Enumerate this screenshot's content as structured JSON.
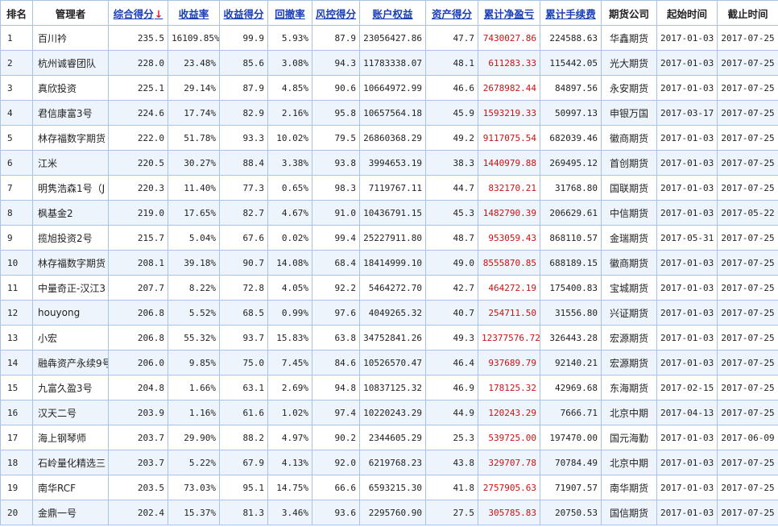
{
  "table": {
    "headers": {
      "rank": "排名",
      "manager": "管理者",
      "score": "综合得分",
      "score_sort_icon": "↓",
      "return_rate": "收益率",
      "return_score": "收益得分",
      "drawdown": "回撤率",
      "risk_score": "风控得分",
      "equity": "账户权益",
      "asset_score": "资产得分",
      "net_pnl": "累计净盈亏",
      "fees": "累计手续费",
      "broker": "期货公司",
      "start": "起始时间",
      "end": "截止时间"
    },
    "rows": [
      {
        "rank": "1",
        "manager": "百川衿",
        "score": "235.5",
        "return_rate": "16109.85%",
        "return_score": "99.9",
        "drawdown": "5.93%",
        "risk_score": "87.9",
        "equity": "23056427.86",
        "asset_score": "47.7",
        "net_pnl": "7430027.86",
        "fees": "224588.63",
        "broker": "华鑫期货",
        "start": "2017-01-03",
        "end": "2017-07-25"
      },
      {
        "rank": "2",
        "manager": "杭州诚睿团队",
        "score": "228.0",
        "return_rate": "23.48%",
        "return_score": "85.6",
        "drawdown": "3.08%",
        "risk_score": "94.3",
        "equity": "11783338.07",
        "asset_score": "48.1",
        "net_pnl": "611283.33",
        "fees": "115442.05",
        "broker": "光大期货",
        "start": "2017-01-03",
        "end": "2017-07-25"
      },
      {
        "rank": "3",
        "manager": "真欣投资",
        "score": "225.1",
        "return_rate": "29.14%",
        "return_score": "87.9",
        "drawdown": "4.85%",
        "risk_score": "90.6",
        "equity": "10664972.99",
        "asset_score": "46.6",
        "net_pnl": "2678982.44",
        "fees": "84897.56",
        "broker": "永安期货",
        "start": "2017-01-03",
        "end": "2017-07-25"
      },
      {
        "rank": "4",
        "manager": "君信康富3号",
        "score": "224.6",
        "return_rate": "17.74%",
        "return_score": "82.9",
        "drawdown": "2.16%",
        "risk_score": "95.8",
        "equity": "10657564.18",
        "asset_score": "45.9",
        "net_pnl": "1593219.33",
        "fees": "50997.13",
        "broker": "申银万国",
        "start": "2017-03-17",
        "end": "2017-07-25"
      },
      {
        "rank": "5",
        "manager": "林存福数字期货",
        "score": "222.0",
        "return_rate": "51.78%",
        "return_score": "93.3",
        "drawdown": "10.02%",
        "risk_score": "79.5",
        "equity": "26860368.29",
        "asset_score": "49.2",
        "net_pnl": "9117075.54",
        "fees": "682039.46",
        "broker": "徽商期货",
        "start": "2017-01-03",
        "end": "2017-07-25"
      },
      {
        "rank": "6",
        "manager": "江米",
        "score": "220.5",
        "return_rate": "30.27%",
        "return_score": "88.4",
        "drawdown": "3.38%",
        "risk_score": "93.8",
        "equity": "3994653.19",
        "asset_score": "38.3",
        "net_pnl": "1440979.88",
        "fees": "269495.12",
        "broker": "首创期货",
        "start": "2017-01-03",
        "end": "2017-07-25"
      },
      {
        "rank": "7",
        "manager": "明隽浩森1号（J",
        "score": "220.3",
        "return_rate": "11.40%",
        "return_score": "77.3",
        "drawdown": "0.65%",
        "risk_score": "98.3",
        "equity": "7119767.11",
        "asset_score": "44.7",
        "net_pnl": "832170.21",
        "fees": "31768.80",
        "broker": "国联期货",
        "start": "2017-01-03",
        "end": "2017-07-25"
      },
      {
        "rank": "8",
        "manager": "枫基金2",
        "score": "219.0",
        "return_rate": "17.65%",
        "return_score": "82.7",
        "drawdown": "4.67%",
        "risk_score": "91.0",
        "equity": "10436791.15",
        "asset_score": "45.3",
        "net_pnl": "1482790.39",
        "fees": "206629.61",
        "broker": "中信期货",
        "start": "2017-01-03",
        "end": "2017-05-22"
      },
      {
        "rank": "9",
        "manager": "揽旭投资2号",
        "score": "215.7",
        "return_rate": "5.04%",
        "return_score": "67.6",
        "drawdown": "0.02%",
        "risk_score": "99.4",
        "equity": "25227911.80",
        "asset_score": "48.7",
        "net_pnl": "953059.43",
        "fees": "868110.57",
        "broker": "金瑞期货",
        "start": "2017-05-31",
        "end": "2017-07-25"
      },
      {
        "rank": "10",
        "manager": "林存福数字期货",
        "score": "208.1",
        "return_rate": "39.18%",
        "return_score": "90.7",
        "drawdown": "14.08%",
        "risk_score": "68.4",
        "equity": "18414999.10",
        "asset_score": "49.0",
        "net_pnl": "8555870.85",
        "fees": "688189.15",
        "broker": "徽商期货",
        "start": "2017-01-03",
        "end": "2017-07-25"
      },
      {
        "rank": "11",
        "manager": "中量奇正-汉江3",
        "score": "207.7",
        "return_rate": "8.22%",
        "return_score": "72.8",
        "drawdown": "4.05%",
        "risk_score": "92.2",
        "equity": "5464272.70",
        "asset_score": "42.7",
        "net_pnl": "464272.19",
        "fees": "175400.83",
        "broker": "宝城期货",
        "start": "2017-01-03",
        "end": "2017-07-25"
      },
      {
        "rank": "12",
        "manager": "houyong",
        "score": "206.8",
        "return_rate": "5.52%",
        "return_score": "68.5",
        "drawdown": "0.99%",
        "risk_score": "97.6",
        "equity": "4049265.32",
        "asset_score": "40.7",
        "net_pnl": "254711.50",
        "fees": "31556.80",
        "broker": "兴证期货",
        "start": "2017-01-03",
        "end": "2017-07-25"
      },
      {
        "rank": "13",
        "manager": "小宏",
        "score": "206.8",
        "return_rate": "55.32%",
        "return_score": "93.7",
        "drawdown": "15.83%",
        "risk_score": "63.8",
        "equity": "34752841.26",
        "asset_score": "49.3",
        "net_pnl": "12377576.72",
        "fees": "326443.28",
        "broker": "宏源期货",
        "start": "2017-01-03",
        "end": "2017-07-25"
      },
      {
        "rank": "14",
        "manager": "融犇资产永续9号",
        "score": "206.0",
        "return_rate": "9.85%",
        "return_score": "75.0",
        "drawdown": "7.45%",
        "risk_score": "84.6",
        "equity": "10526570.47",
        "asset_score": "46.4",
        "net_pnl": "937689.79",
        "fees": "92140.21",
        "broker": "宏源期货",
        "start": "2017-01-03",
        "end": "2017-07-25"
      },
      {
        "rank": "15",
        "manager": "九富久盈3号",
        "score": "204.8",
        "return_rate": "1.66%",
        "return_score": "63.1",
        "drawdown": "2.69%",
        "risk_score": "94.8",
        "equity": "10837125.32",
        "asset_score": "46.9",
        "net_pnl": "178125.32",
        "fees": "42969.68",
        "broker": "东海期货",
        "start": "2017-02-15",
        "end": "2017-07-25"
      },
      {
        "rank": "16",
        "manager": "汉天二号",
        "score": "203.9",
        "return_rate": "1.16%",
        "return_score": "61.6",
        "drawdown": "1.02%",
        "risk_score": "97.4",
        "equity": "10220243.29",
        "asset_score": "44.9",
        "net_pnl": "120243.29",
        "fees": "7666.71",
        "broker": "北京中期",
        "start": "2017-04-13",
        "end": "2017-07-25"
      },
      {
        "rank": "17",
        "manager": "海上钢琴师",
        "score": "203.7",
        "return_rate": "29.90%",
        "return_score": "88.2",
        "drawdown": "4.97%",
        "risk_score": "90.2",
        "equity": "2344605.29",
        "asset_score": "25.3",
        "net_pnl": "539725.00",
        "fees": "197470.00",
        "broker": "国元海勤",
        "start": "2017-01-03",
        "end": "2017-06-09"
      },
      {
        "rank": "18",
        "manager": "石岭量化精选三",
        "score": "203.7",
        "return_rate": "5.22%",
        "return_score": "67.9",
        "drawdown": "4.13%",
        "risk_score": "92.0",
        "equity": "6219768.23",
        "asset_score": "43.8",
        "net_pnl": "329707.78",
        "fees": "70784.49",
        "broker": "北京中期",
        "start": "2017-01-03",
        "end": "2017-07-25"
      },
      {
        "rank": "19",
        "manager": "南华RCF",
        "score": "203.5",
        "return_rate": "73.03%",
        "return_score": "95.1",
        "drawdown": "14.75%",
        "risk_score": "66.6",
        "equity": "6593215.30",
        "asset_score": "41.8",
        "net_pnl": "2757905.63",
        "fees": "71907.57",
        "broker": "南华期货",
        "start": "2017-01-03",
        "end": "2017-07-25"
      },
      {
        "rank": "20",
        "manager": "金鼎一号",
        "score": "202.4",
        "return_rate": "15.37%",
        "return_score": "81.3",
        "drawdown": "3.46%",
        "risk_score": "93.6",
        "equity": "2295760.90",
        "asset_score": "27.5",
        "net_pnl": "305785.83",
        "fees": "20750.53",
        "broker": "国信期货",
        "start": "2017-01-03",
        "end": "2017-07-25"
      }
    ]
  },
  "colors": {
    "link": "#1a3fb5",
    "loss_gain_red": "#cc1111",
    "border": "#a9c3e6",
    "row_alt": "#eef4fb"
  }
}
